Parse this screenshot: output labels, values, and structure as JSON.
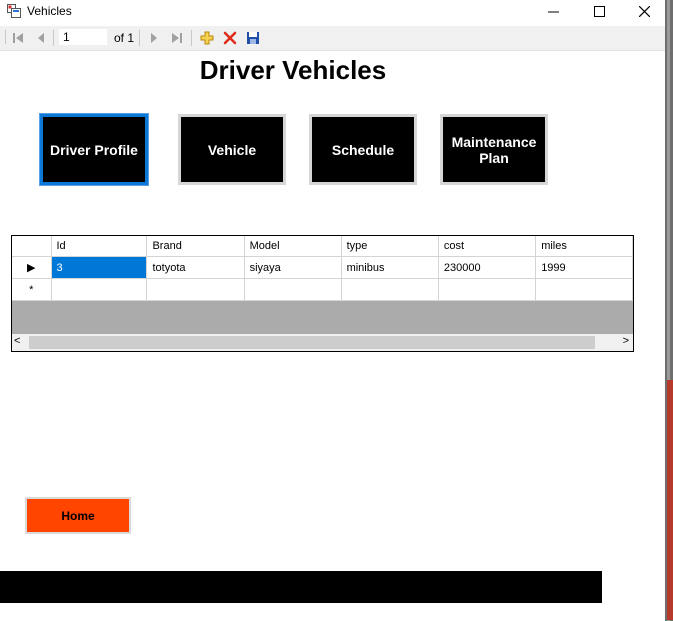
{
  "window": {
    "title": "Vehicles",
    "minimize_glyph": "—",
    "maximize_glyph": "☐",
    "close_glyph": "✕"
  },
  "toolbar": {
    "move_first_icon": "move-first-icon",
    "move_prev_icon": "move-previous-icon",
    "position": "1",
    "count_label": "of 1",
    "move_next_icon": "move-next-icon",
    "move_last_icon": "move-last-icon",
    "add_icon": "add-new-icon",
    "delete_icon": "delete-icon",
    "save_icon": "save-icon"
  },
  "page": {
    "title": "Driver Vehicles"
  },
  "nav": {
    "driver_profile": "Driver Profile",
    "vehicle": "Vehicle",
    "schedule": "Schedule",
    "maintenance_line1": "Maintenance",
    "maintenance_line2": "Plan"
  },
  "grid": {
    "columns": [
      "Id",
      "Brand",
      "Model",
      "type",
      "cost",
      "miles"
    ],
    "rows": [
      {
        "indicator": "▶",
        "cells": [
          "3",
          "totyota",
          "siyaya",
          "minibus",
          "230000",
          "1999"
        ]
      }
    ],
    "new_row_indicator": "*",
    "scroll_left": "<",
    "scroll_right": ">"
  },
  "home": {
    "label": "Home"
  },
  "colors": {
    "nav_button_bg": "#000000",
    "home_button_bg": "#ff4500",
    "selected_cell": "#0078d7",
    "grid_background": "#ababab"
  }
}
